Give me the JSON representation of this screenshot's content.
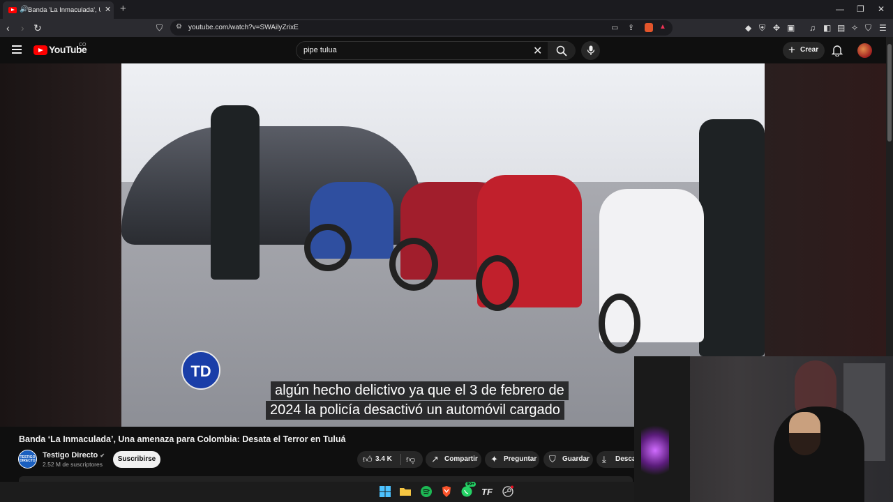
{
  "browser": {
    "tab_title": "Banda 'La Inmaculada', Una amenaza para Colombia",
    "url": "youtube.com/watch?v=SWAilyZrixE",
    "new_tab_icon": "plus-icon",
    "back_icon": "arrow-left-icon",
    "forward_icon": "arrow-right-icon",
    "reload_icon": "reload-icon"
  },
  "youtube": {
    "logo_text": "YouTube",
    "country_code": "CO",
    "search_value": "pipe tulua",
    "create_label": "Crear"
  },
  "video": {
    "overlay_logo": "TD",
    "subtitle_line1": "algún hecho delictivo ya que el 3 de febrero de",
    "subtitle_line2": "2024 la policía desactivó un automóvil cargado",
    "title": "Banda ‘La Inmaculada’, Una amenaza para Colombia: Desata el Terror en Tuluá"
  },
  "channel": {
    "avatar_text": "TESTIGO DIRECTO",
    "name": "Testigo Directo",
    "verified": "✔",
    "subscribers": "2.52 M de suscriptores",
    "subscribe_label": "Suscribirse"
  },
  "actions": {
    "likes": "3.4 K",
    "share_label": "Compartir",
    "ask_label": "Preguntar",
    "save_label": "Guardar",
    "download_label": "Descar"
  },
  "taskbar": {
    "badge_whatsapp": "99+"
  },
  "colors": {
    "accent": "#ff0000",
    "background": "#0f0f0f",
    "pill": "#272727"
  }
}
